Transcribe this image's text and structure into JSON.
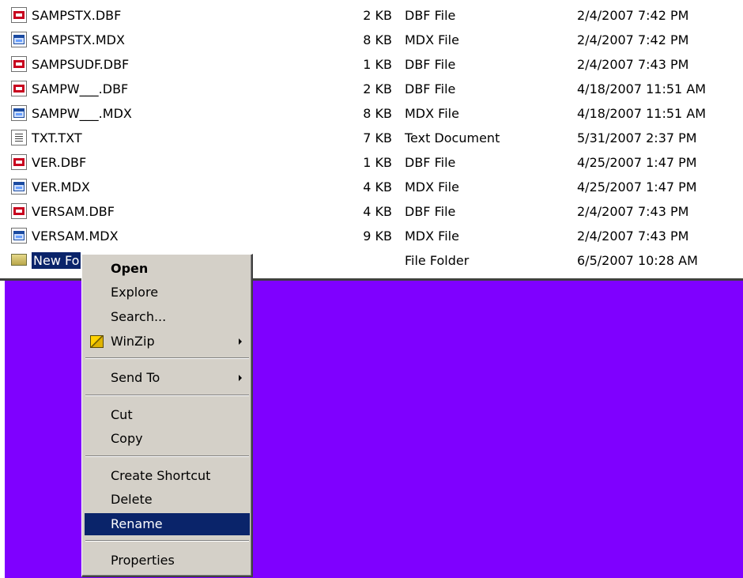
{
  "files": [
    {
      "name": "SAMPSTX.DBF",
      "size": "2 KB",
      "type": "DBF File",
      "modified": "2/4/2007 7:42 PM",
      "icon": "dbf-file-icon"
    },
    {
      "name": "SAMPSTX.MDX",
      "size": "8 KB",
      "type": "MDX File",
      "modified": "2/4/2007 7:42 PM",
      "icon": "mdx-file-icon"
    },
    {
      "name": "SAMPSUDF.DBF",
      "size": "1 KB",
      "type": "DBF File",
      "modified": "2/4/2007 7:43 PM",
      "icon": "dbf-file-icon"
    },
    {
      "name": "SAMPW___.DBF",
      "size": "2 KB",
      "type": "DBF File",
      "modified": "4/18/2007 11:51 AM",
      "icon": "dbf-file-icon"
    },
    {
      "name": "SAMPW___.MDX",
      "size": "8 KB",
      "type": "MDX File",
      "modified": "4/18/2007 11:51 AM",
      "icon": "mdx-file-icon"
    },
    {
      "name": "TXT.TXT",
      "size": "7 KB",
      "type": "Text Document",
      "modified": "5/31/2007 2:37 PM",
      "icon": "text-file-icon"
    },
    {
      "name": "VER.DBF",
      "size": "1 KB",
      "type": "DBF File",
      "modified": "4/25/2007 1:47 PM",
      "icon": "dbf-file-icon"
    },
    {
      "name": "VER.MDX",
      "size": "4 KB",
      "type": "MDX File",
      "modified": "4/25/2007 1:47 PM",
      "icon": "mdx-file-icon"
    },
    {
      "name": "VERSAM.DBF",
      "size": "4 KB",
      "type": "DBF File",
      "modified": "2/4/2007 7:43 PM",
      "icon": "dbf-file-icon"
    },
    {
      "name": "VERSAM.MDX",
      "size": "9 KB",
      "type": "MDX File",
      "modified": "2/4/2007 7:43 PM",
      "icon": "mdx-file-icon"
    },
    {
      "name": "New Fo",
      "size": "",
      "type": "File Folder",
      "modified": "6/5/2007 10:28 AM",
      "icon": "folder-icon",
      "selected": true
    }
  ],
  "context_menu": {
    "items": [
      {
        "label": "Open",
        "default": true
      },
      {
        "label": "Explore"
      },
      {
        "label": "Search..."
      },
      {
        "label": "WinZip",
        "icon": "winzip-icon",
        "submenu": true
      },
      {
        "label": "Send To",
        "submenu": true
      },
      {
        "label": "Cut"
      },
      {
        "label": "Copy"
      },
      {
        "label": "Create Shortcut"
      },
      {
        "label": "Delete"
      },
      {
        "label": "Rename",
        "highlighted": true
      },
      {
        "label": "Properties"
      }
    ]
  },
  "colors": {
    "desktop_background": "#7f00ff",
    "selection_highlight": "#0a246a",
    "menu_background": "#d4d0c8"
  }
}
